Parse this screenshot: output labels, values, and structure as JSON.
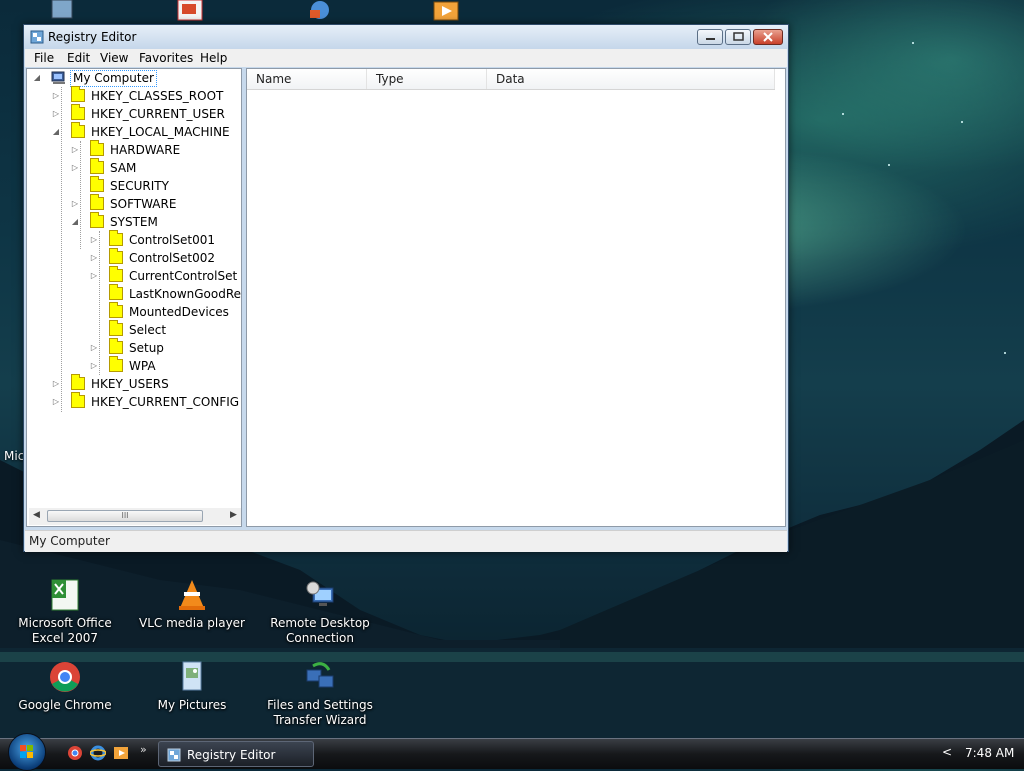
{
  "window": {
    "title": "Registry Editor",
    "menu": [
      "File",
      "Edit",
      "View",
      "Favorites",
      "Help"
    ]
  },
  "tree": {
    "root": "My Computer",
    "hives": {
      "classes_root": "HKEY_CLASSES_ROOT",
      "current_user": "HKEY_CURRENT_USER",
      "local_machine": "HKEY_LOCAL_MACHINE",
      "users": "HKEY_USERS",
      "current_config": "HKEY_CURRENT_CONFIG"
    },
    "hklm_children": [
      "HARDWARE",
      "SAM",
      "SECURITY",
      "SOFTWARE",
      "SYSTEM"
    ],
    "system_children": [
      "ControlSet001",
      "ControlSet002",
      "CurrentControlSet",
      "LastKnownGoodReco",
      "MountedDevices",
      "Select",
      "Setup",
      "WPA"
    ],
    "scroll_thumb_glyph": "III"
  },
  "list": {
    "columns": [
      "Name",
      "Type",
      "Data"
    ]
  },
  "status": {
    "text": "My Computer"
  },
  "desktop": {
    "edge_text": "Mic",
    "icons": [
      {
        "label": "Microsoft Office Excel 2007"
      },
      {
        "label": "VLC media player"
      },
      {
        "label": "Remote Desktop Connection"
      },
      {
        "label": "Google Chrome"
      },
      {
        "label": "My Pictures"
      },
      {
        "label": "Files and Settings Transfer Wizard"
      }
    ]
  },
  "taskbar": {
    "task_label": "Registry Editor",
    "clock": "7:48 AM",
    "more_glyph": "»",
    "tray_chevron": "<"
  },
  "colors": {
    "folder": "#ffff00",
    "selection_outline": "#3399ff"
  }
}
